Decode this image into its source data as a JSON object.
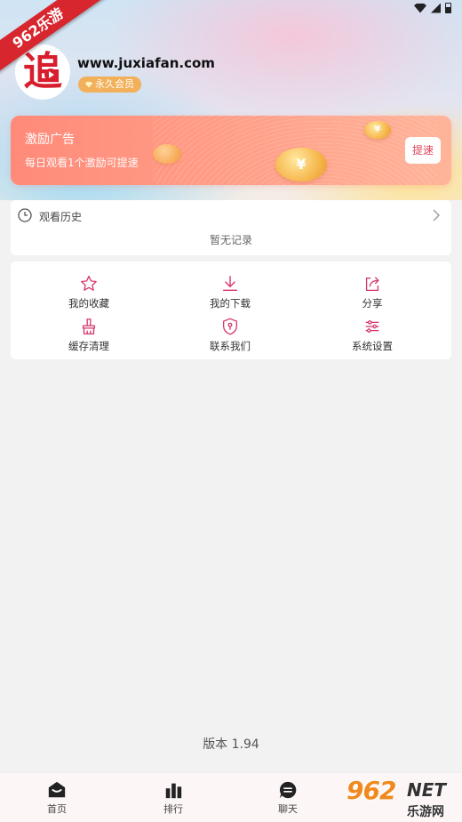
{
  "watermark_corner": {
    "text": "962乐游"
  },
  "status_bar": {
    "icons": [
      "wifi-icon",
      "signal-icon",
      "battery-icon"
    ]
  },
  "profile": {
    "username": "www.juxiafan.com",
    "badge": "永久会员",
    "avatar_char": "追"
  },
  "ad_card": {
    "title": "激励广告",
    "subtitle": "每日观看1个激励可提速",
    "coin_symbol": "¥",
    "button": "提速"
  },
  "history": {
    "title": "观看历史",
    "empty_text": "暂无记录"
  },
  "menu": [
    {
      "label": "我的收藏",
      "icon": "star-icon"
    },
    {
      "label": "我的下载",
      "icon": "download-icon"
    },
    {
      "label": "分享",
      "icon": "share-icon"
    },
    {
      "label": "缓存清理",
      "icon": "brush-icon"
    },
    {
      "label": "联系我们",
      "icon": "shield-icon"
    },
    {
      "label": "系统设置",
      "icon": "sliders-icon"
    }
  ],
  "version": "版本 1.94",
  "tabs": [
    {
      "label": "首页",
      "icon": "home-icon"
    },
    {
      "label": "排行",
      "icon": "bar-chart-icon"
    },
    {
      "label": "聊天",
      "icon": "chat-icon"
    }
  ],
  "watermark": {
    "main": "962",
    "net": "NET",
    "sub": "乐游网"
  },
  "colors": {
    "accent": "#d6336c",
    "brand_red": "#d81e2d",
    "ad_gradient_start": "#ff8a7a",
    "vip_badge": "#f2b05a"
  }
}
